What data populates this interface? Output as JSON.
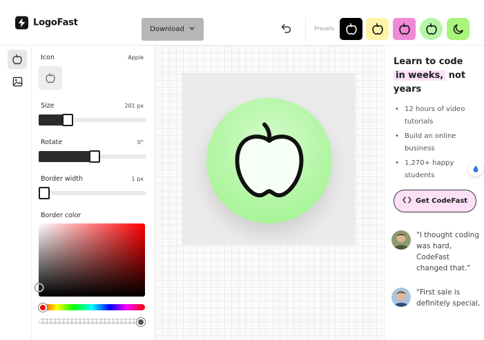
{
  "header": {
    "brand": "LogoFast",
    "download_label": "Download",
    "presets_label": "Presets",
    "presets": [
      {
        "bg": "#000000",
        "fg": "#ffffff",
        "icon": "apple-icon"
      },
      {
        "bg": "#fff3a8",
        "fg": "#111111",
        "icon": "apple-icon"
      },
      {
        "bg": "#f089d6",
        "fg": "#111111",
        "icon": "apple-icon"
      },
      {
        "bg": "#b4f6a6",
        "fg": "#111111",
        "icon": "apple-icon"
      },
      {
        "bg": "#a7f57a",
        "fg": "#111111",
        "icon": "moon-icon"
      }
    ]
  },
  "rail": {
    "items": [
      {
        "icon": "apple-icon",
        "active": true
      },
      {
        "icon": "image-icon",
        "active": false
      }
    ]
  },
  "panel": {
    "icon_label": "Icon",
    "icon_value": "Apple",
    "size_label": "Size",
    "size_value": "201 px",
    "size_fraction": 0.24,
    "rotate_label": "Rotate",
    "rotate_value": "0°",
    "rotate_fraction": 0.52,
    "border_width_label": "Border width",
    "border_width_value": "1 px",
    "border_width_fraction": 0.0,
    "border_color_label": "Border color"
  },
  "canvas": {
    "logo_bg": "#b4f6a6",
    "logo_icon": "apple-icon"
  },
  "ad": {
    "title_part1": "Learn to code",
    "title_highlight": "in weeks,",
    "title_part2": "not years",
    "bullets": [
      "12 hours of video tutorials",
      "Build an online business",
      "1,270+ happy students"
    ],
    "cta_label": "Get CodeFast",
    "testimonials": [
      {
        "quote": "\"I thought coding was hard, CodeFast changed that.\""
      },
      {
        "quote": "\"First sale is definitely special,"
      }
    ]
  }
}
